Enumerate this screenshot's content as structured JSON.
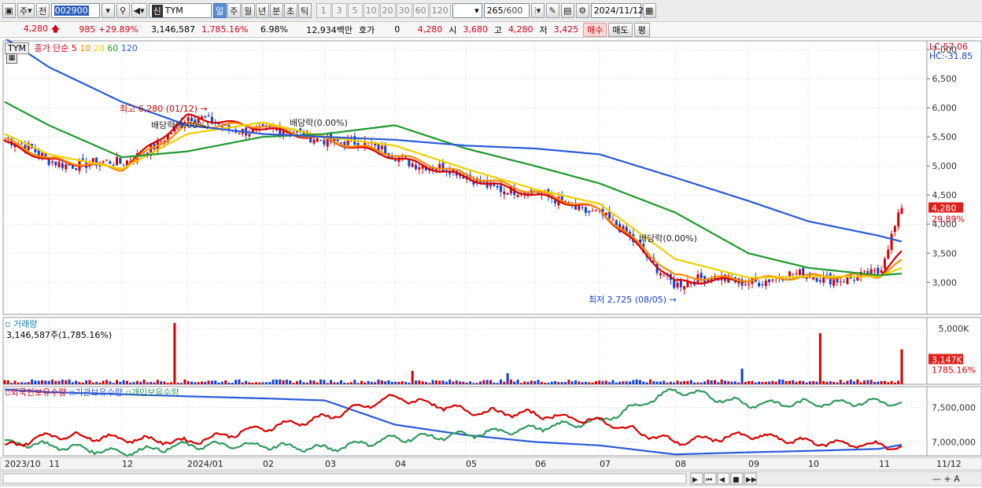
{
  "toolbar": {
    "market": "주",
    "prev_label": "전",
    "code": "002900",
    "name_prefix": "신",
    "name": "TYM",
    "periods": [
      "일",
      "주",
      "월",
      "년",
      "분",
      "초",
      "틱"
    ],
    "active_period": "일",
    "intervals": [
      "1",
      "3",
      "5",
      "10",
      "20",
      "30",
      "60",
      "120"
    ],
    "count": "265",
    "total": "/600",
    "date": "2024/11/12"
  },
  "quote": {
    "price": "4,280",
    "change": "985",
    "change_pct": "+29.89%",
    "volume": "3,146,587",
    "volume_pct": "1,785.16%",
    "turnover": "6.98%",
    "amount": "12,934백만",
    "hoga_label": "호가",
    "hoga_value": "0",
    "hoga_price": "4,280",
    "open_label": "시",
    "open": "3,680",
    "high_label": "고",
    "high": "4,280",
    "low_label": "저",
    "low": "3,425",
    "buy_label": "매수",
    "sell_label": "매도",
    "eval_label": "평"
  },
  "price_panel": {
    "symbol": "TYM",
    "legend_title": "종가 단순",
    "ma_periods": [
      "5",
      "10",
      "20",
      "60",
      "120"
    ],
    "lc": "LC:57.06",
    "hc": "HC:-31.85",
    "last_price_label": "4,280",
    "last_pct_label": "29.89%",
    "annotations": {
      "high": "최고 6,280 (01/12)",
      "low": "최저 2,725 (08/05)",
      "dividend": "배당락(0.00%)"
    }
  },
  "volume_panel": {
    "title": "거래량",
    "subtitle": "3,146,587주(1,785.16%)",
    "last_label": "3,147K",
    "last_pct": "1785.16%"
  },
  "holdings_panel": {
    "series_labels": [
      "외국인보유수량",
      "기관보유수량",
      "개인보유수량"
    ]
  },
  "colors": {
    "ma5": "#d80000",
    "ma10": "#ff8c00",
    "ma20": "#f0d000",
    "ma60": "#1f9a2c",
    "ma120": "#2a5ad8",
    "up": "#d80000",
    "down": "#1340d6",
    "foreign": "#d80000",
    "institution": "#2a5ad8",
    "individual": "#2e9a5c"
  },
  "chart_data": [
    {
      "type": "candlestick",
      "title": "TYM",
      "x": [
        "2023/10",
        "11",
        "12",
        "2024/01",
        "02",
        "03",
        "04",
        "05",
        "06",
        "07",
        "08",
        "09",
        "10",
        "11"
      ],
      "y_ticks": [
        3000,
        3500,
        4000,
        4500,
        5000,
        5500,
        6000,
        6500,
        7000
      ],
      "ylim": [
        2450,
        7150
      ],
      "series": [
        {
          "name": "종가",
          "x": [
            "2023/10",
            "11",
            "12",
            "2024/01",
            "02",
            "03",
            "04",
            "05",
            "06",
            "07",
            "08",
            "09",
            "10",
            "11",
            "11/12"
          ],
          "values": [
            5450,
            5100,
            5000,
            5800,
            5600,
            5500,
            5200,
            4800,
            4500,
            4200,
            3000,
            3050,
            3100,
            3100,
            4280
          ]
        },
        {
          "name": "5",
          "values": [
            5400,
            5100,
            4950,
            5850,
            5650,
            5450,
            5150,
            4800,
            4500,
            4250,
            3000,
            3050,
            3100,
            3120,
            3500
          ]
        },
        {
          "name": "10",
          "values": [
            5450,
            5120,
            4950,
            5700,
            5700,
            5450,
            5200,
            4850,
            4550,
            4250,
            3100,
            3050,
            3100,
            3120,
            3350
          ]
        },
        {
          "name": "20",
          "values": [
            5550,
            5200,
            4950,
            5550,
            5750,
            5500,
            5350,
            4950,
            4600,
            4350,
            3400,
            3080,
            3100,
            3100,
            3250
          ]
        },
        {
          "name": "60",
          "values": [
            6100,
            5700,
            5150,
            5250,
            5500,
            5550,
            5700,
            5300,
            5000,
            4700,
            4200,
            3500,
            3250,
            3120,
            3150
          ]
        },
        {
          "name": "120",
          "values": [
            7200,
            6700,
            6100,
            5700,
            5550,
            5500,
            5450,
            5350,
            5300,
            5200,
            4800,
            4400,
            4050,
            3800,
            3700
          ]
        }
      ],
      "high": {
        "date": "01/12",
        "value": 6280
      },
      "low": {
        "date": "08/05",
        "value": 2725
      },
      "last": {
        "value": 4280,
        "change_pct": 29.89
      }
    },
    {
      "type": "bar",
      "title": "거래량",
      "y_ticks": [
        "5,000K"
      ],
      "ylim": [
        0,
        6000
      ],
      "series": [
        {
          "name": "거래량",
          "unit": "K",
          "last": 3147
        }
      ]
    },
    {
      "type": "line",
      "y_ticks": [
        7000000,
        7500000
      ],
      "ylim": [
        6800000,
        7800000
      ],
      "series": [
        {
          "name": "외국인보유수량"
        },
        {
          "name": "기관보유수량"
        },
        {
          "name": "개인보유수량"
        }
      ]
    }
  ]
}
